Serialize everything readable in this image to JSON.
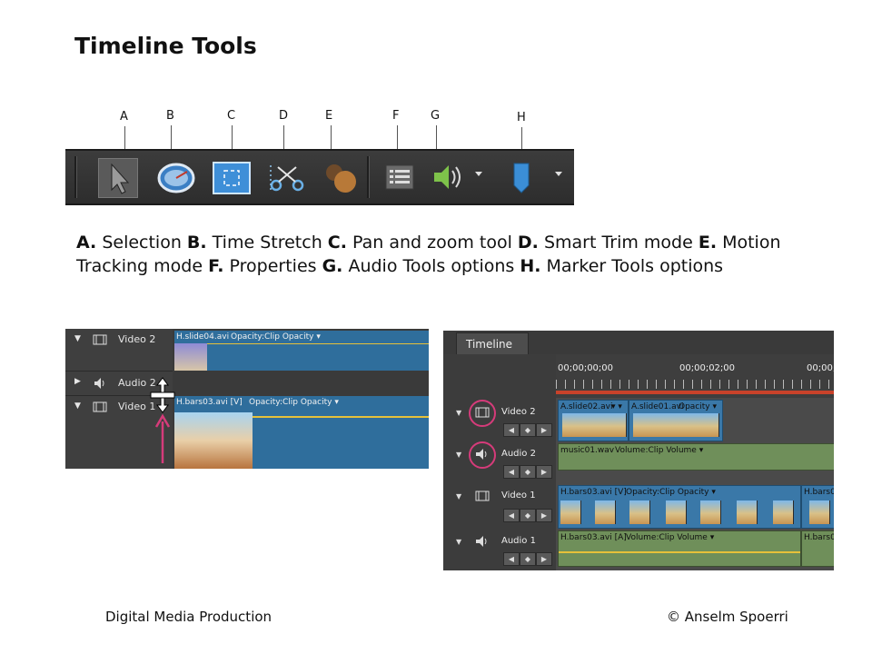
{
  "title": "Timeline Tools",
  "callouts": [
    "A",
    "B",
    "C",
    "D",
    "E",
    "F",
    "G",
    "H"
  ],
  "caption": [
    {
      "letter": "A.",
      "text": " Selection "
    },
    {
      "letter": "B.",
      "text": " Time Stretch "
    },
    {
      "letter": "C.",
      "text": " Pan and zoom tool "
    },
    {
      "letter": "D.",
      "text": " Smart Trim mode "
    },
    {
      "letter": "E.",
      "text": " Motion Tracking mode "
    },
    {
      "letter": "F.",
      "text": " Properties "
    },
    {
      "letter": "G.",
      "text": " Audio Tools options "
    },
    {
      "letter": "H.",
      "text": " Marker Tools options"
    }
  ],
  "left_shot": {
    "tracks": [
      "Video 2",
      "Audio 2",
      "Video 1"
    ],
    "clip_video2": "H.slide04.avi",
    "clip_video2_opacity": "Opacity:Clip Opacity ▾",
    "clip_video1": "H.bars03.avi [V]",
    "clip_video1_opacity": "Opacity:Clip Opacity ▾"
  },
  "right_shot": {
    "tab": "Timeline",
    "time_start": "00;00;00;00",
    "time_mid": "00;00;02;00",
    "time_end": "00;00;",
    "tracks": [
      "Video 2",
      "Audio 2",
      "Video 1",
      "Audio 1"
    ],
    "clips": {
      "v2a": "A.slide02.avi",
      "v2a_menu": "▾ ▾",
      "v2b": "A.slide01.avi",
      "v2_opacity": "Opacity ▾",
      "a2": "music01.wav",
      "a2_volume": "Volume:Clip Volume ▾",
      "v1": "H.bars03.avi [V]",
      "v1_opacity": "Opacity:Clip Opacity ▾",
      "v1_end": "H.bars0",
      "a1": "H.bars03.avi [A]",
      "a1_volume": "Volume:Clip Volume ▾",
      "a1_end": "H.bars0"
    }
  },
  "footer_left": "Digital Media Production",
  "footer_right": "© Anselm Spoerri",
  "colors": {
    "highlight_ring": "#d63b7a",
    "arrow": "#d63b7a",
    "toolbar_bg": "#333333",
    "video_clip": "#3a78a8",
    "audio_clip": "#6f8f5a"
  }
}
